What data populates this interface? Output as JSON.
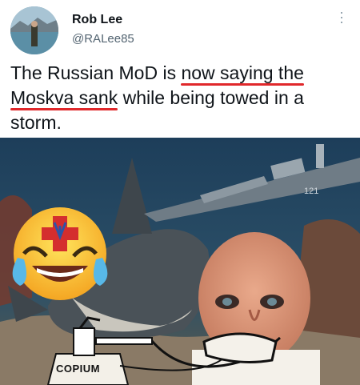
{
  "author": {
    "name": "Rob Lee",
    "handle": "@RALee85",
    "avatar_icon": "profile-photo"
  },
  "tweet": {
    "text_parts": [
      {
        "text": "The Russian MoD is ",
        "highlight": false
      },
      {
        "text": "now saying the",
        "highlight": true
      },
      {
        "text": " ",
        "highlight": false
      },
      {
        "text": "Moskva sank",
        "highlight": true
      },
      {
        "text": " while being towed in a storm.",
        "highlight": false
      }
    ],
    "highlight_color": "#e0282b"
  },
  "media": {
    "meme_label": "COPIUM",
    "ship_number": "121",
    "emoji_icon": "laughing-crying-emoji-with-trident"
  },
  "menu_icon": "more-options-icon"
}
